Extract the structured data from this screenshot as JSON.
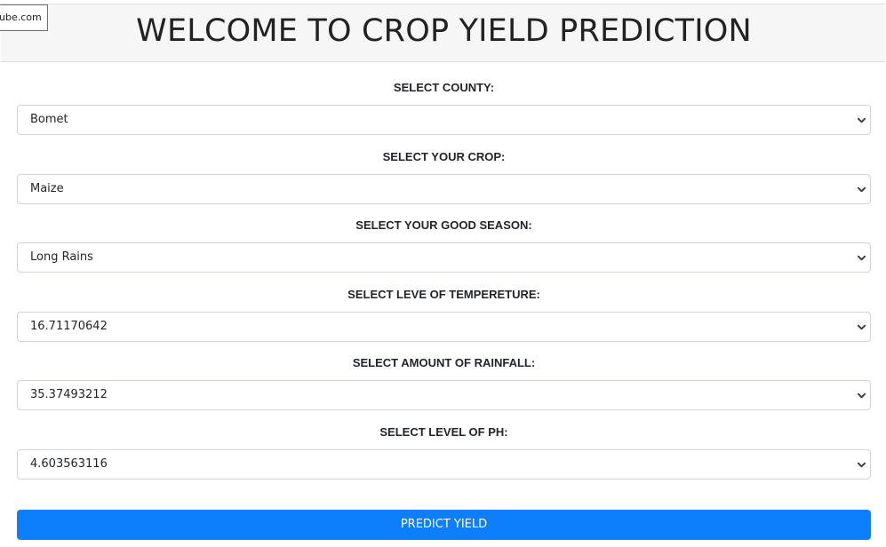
{
  "tooltip_fragment": "ube.com",
  "header": {
    "title": "WELCOME TO CROP YIELD PREDICTION"
  },
  "form": {
    "county": {
      "label": "SELECT COUNTY:",
      "value": "Bomet"
    },
    "crop": {
      "label": "SELECT YOUR CROP:",
      "value": "Maize"
    },
    "season": {
      "label": "SELECT YOUR GOOD SEASON:",
      "value": "Long Rains"
    },
    "temperature": {
      "label": "SELECT LEVE OF TEMPERETURE:",
      "value": "16.71170642"
    },
    "rainfall": {
      "label": "SELECT AMOUNT OF RAINFALL:",
      "value": "35.37493212"
    },
    "ph": {
      "label": "SELECT LEVEL OF PH:",
      "value": "4.603563116"
    },
    "submit_label": "PREDICT YIELD"
  },
  "icons": {
    "select_chevron": "chevron-down-icon"
  },
  "colors": {
    "primary_button": "#0d7efc",
    "header_background": "#f6f6f6"
  }
}
